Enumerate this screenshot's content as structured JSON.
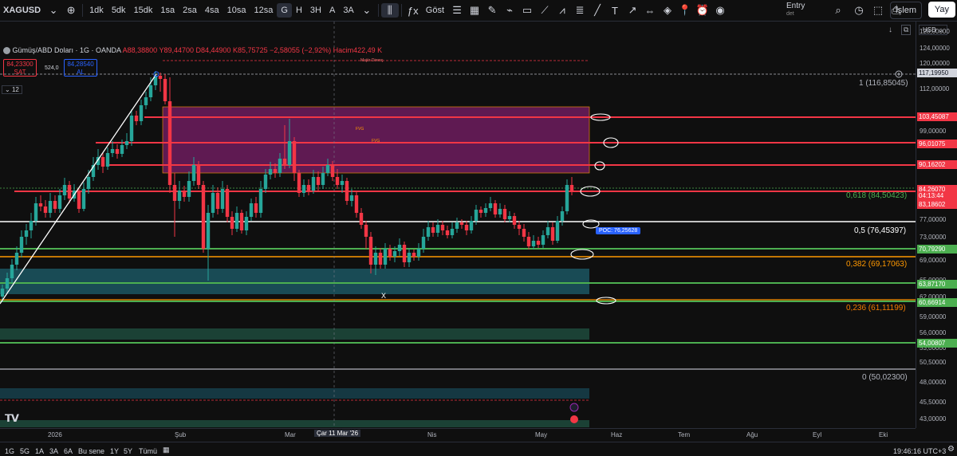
{
  "toolbar": {
    "symbol": "XAGUSD",
    "intervals": [
      "1dk",
      "5dk",
      "15dk",
      "1sa",
      "2sa",
      "4sa",
      "10sa",
      "12sa",
      "G",
      "H",
      "3H",
      "A",
      "3A"
    ],
    "active_interval": "G",
    "indicators_label": "Göst",
    "entry_label": "Entry",
    "entry_sub": "det",
    "login_label": "İşlem",
    "publish_label": "Yay"
  },
  "legend": {
    "title": "Gümüş/ABD Doları · 1G · OANDA",
    "ohlc": "A88,38800 Y89,44700 D84,44900 K85,75725 −2,58055 (−2,92%) Hacim422,49 K",
    "sell_price": "84,23300",
    "sell_label": "SAT",
    "spread": "524,0",
    "buy_price": "84,28540",
    "buy_label": "AL",
    "indicator_count": "12"
  },
  "chart_annotations": {
    "major_label": "Majör Direnç",
    "fvg1": "FVG",
    "fvg2": "FVG",
    "poc": "POC: 76,25628",
    "cursor_x": "X"
  },
  "fib_levels": [
    {
      "label": "1 (116,85045)",
      "color": "#b2b5be"
    },
    {
      "label": "0,618 (84,50423)",
      "color": "#4caf50"
    },
    {
      "label": "0,5 (76,45397)",
      "color": "#ffffff"
    },
    {
      "label": "0,382 (69,17063)",
      "color": "#ff9800"
    },
    {
      "label": "0,236 (61,11199)",
      "color": "#f57c00"
    },
    {
      "label": "0 (50,02300)",
      "color": "#b2b5be"
    }
  ],
  "price_axis": {
    "currency": "USD",
    "ticks": [
      "128,00000",
      "124,00000",
      "120,00000",
      "112,00000",
      "99,00000",
      "95,00000",
      "77,00000",
      "73,00000",
      "69,00000",
      "65,00000",
      "62,00000",
      "59,00000",
      "56,00000",
      "53,00000",
      "50,50000",
      "48,00000",
      "45,50000",
      "43,00000"
    ],
    "boxes": [
      {
        "label": "117,19950",
        "bg": "#d1d4dc",
        "fg": "#131722"
      },
      {
        "label": "103,45087",
        "bg": "#f23645",
        "fg": "#ffffff"
      },
      {
        "label": "96,01075",
        "bg": "#f23645",
        "fg": "#ffffff"
      },
      {
        "label": "90,16202",
        "bg": "#f23645",
        "fg": "#ffffff"
      },
      {
        "label": "84,26070",
        "bg": "#f23645",
        "fg": "#ffffff"
      },
      {
        "label": "04:13:44",
        "bg": "#f23645",
        "fg": "#ffffff"
      },
      {
        "label": "83,18602",
        "bg": "#f23645",
        "fg": "#ffffff"
      },
      {
        "label": "70,79290",
        "bg": "#4caf50",
        "fg": "#ffffff"
      },
      {
        "label": "63,87170",
        "bg": "#4caf50",
        "fg": "#ffffff"
      },
      {
        "label": "60,66914",
        "bg": "#4caf50",
        "fg": "#ffffff"
      },
      {
        "label": "54,00807",
        "bg": "#4caf50",
        "fg": "#ffffff"
      }
    ]
  },
  "time_axis": [
    "2026",
    "Şub",
    "Mar",
    "Çar 11 Mar '26",
    "Nis",
    "May",
    "Haz",
    "Tem",
    "Ağu",
    "Eyl",
    "Eki"
  ],
  "bottom": {
    "ranges": [
      "1G",
      "5G",
      "1A",
      "3A",
      "6A",
      "Bu sene",
      "1Y",
      "5Y",
      "Tümü"
    ],
    "clock": "19:46:16 UTC+3"
  },
  "colors": {
    "up": "#26a69a",
    "down": "#f23645",
    "resistance": "#f23645",
    "support": "#4caf50",
    "fvg_fill": "#7b1f6a"
  }
}
